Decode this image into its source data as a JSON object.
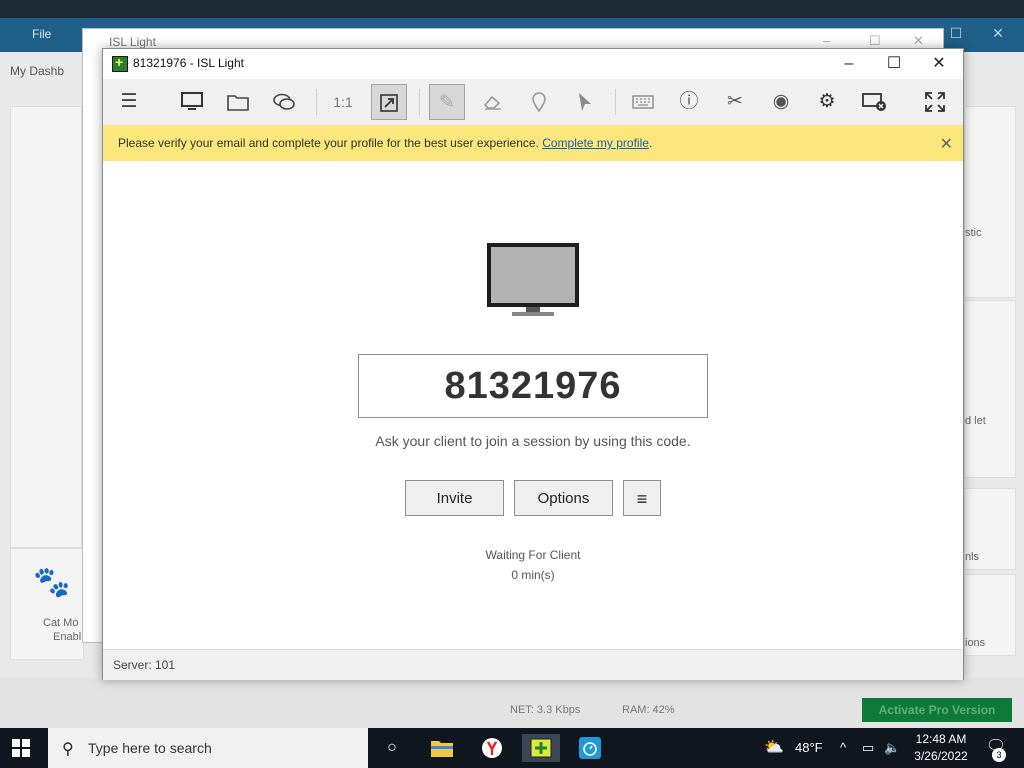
{
  "background": {
    "menu_file": "File",
    "dashboard_label": "My Dashb",
    "ghost_title": "ISL Light",
    "net_label": "NET: 3.3 Kbps",
    "ram_label": "RAM: 42%",
    "pro_button": "Activate Pro Version",
    "side_text_1": "stic",
    "side_text_2": "d let",
    "side_text_3": "nls",
    "side_text_4": "ions",
    "cat_label_1": "Cat Mo",
    "cat_label_2": "Enabl"
  },
  "window": {
    "title": "81321976 - ISL Light",
    "minimize": "–",
    "maximize": "☐",
    "close": "✕"
  },
  "toolbar": {
    "one_to_one": "1:1"
  },
  "notice": {
    "text": "Please verify your email and complete your profile for the best user experience. ",
    "link": "Complete my profile",
    "suffix": ".",
    "close": "✕"
  },
  "session": {
    "code": "81321976",
    "hint": "Ask your client to join a session by using this code.",
    "invite_button": "Invite",
    "options_button": "Options",
    "menu_button": "≡",
    "status": "Waiting For Client",
    "elapsed": "0 min(s)"
  },
  "statusbar": {
    "server": "Server: 101"
  },
  "taskbar": {
    "search_placeholder": "Type here to search",
    "weather": "48°F",
    "time": "12:48 AM",
    "date": "3/26/2022",
    "notification_count": "3"
  },
  "colors": {
    "notice_bg": "#fbe77c",
    "link": "#1a5fb4",
    "pro_green": "#0d7a3a"
  }
}
